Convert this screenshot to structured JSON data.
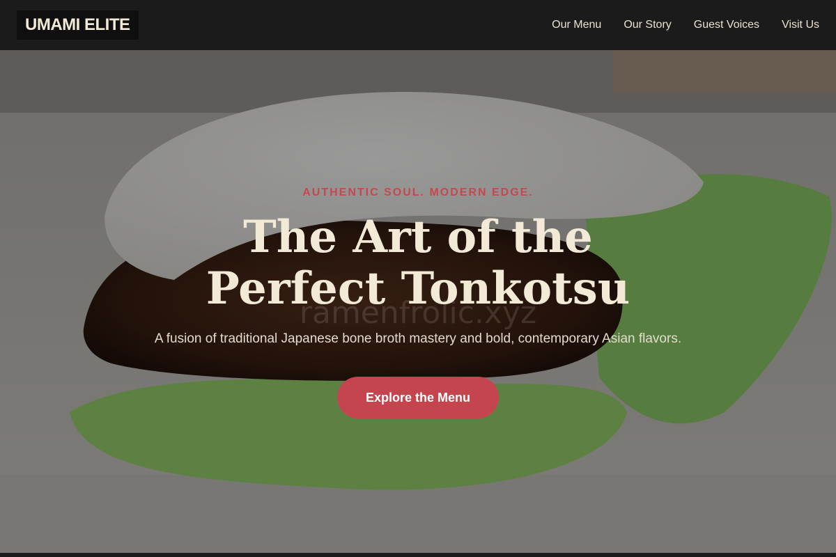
{
  "brand": {
    "logo_text": "UMAMI ELITE"
  },
  "nav": {
    "items": [
      {
        "label": "Our Menu"
      },
      {
        "label": "Our Story"
      },
      {
        "label": "Guest Voices"
      },
      {
        "label": "Visit Us"
      }
    ]
  },
  "hero": {
    "eyebrow": "AUTHENTIC SOUL. MODERN EDGE.",
    "title_line1": "The Art of the",
    "title_line2": "Perfect Tonkotsu",
    "subtitle": "A fusion of traditional Japanese bone broth mastery and bold, contemporary Asian flavors.",
    "cta_label": "Explore the Menu",
    "watermark": "ramenfrolic.xyz"
  },
  "colors": {
    "accent": "#c4454e",
    "cream": "#f2ead7",
    "nav_bg": "#1b1b1b"
  }
}
